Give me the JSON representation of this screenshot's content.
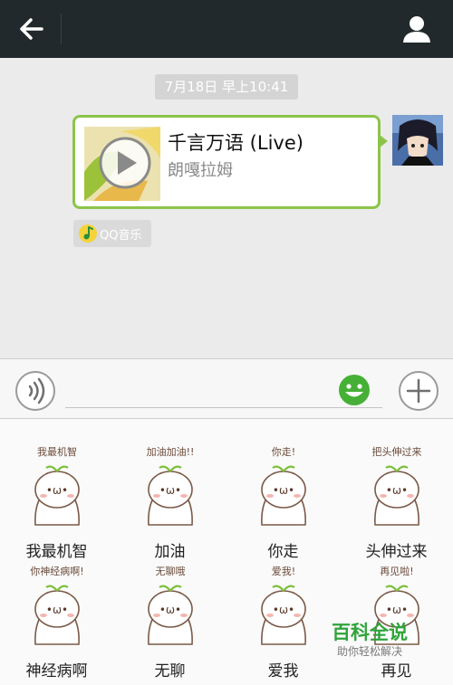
{
  "colors": {
    "topbar": "#22292c",
    "accent_green": "#8cc44b",
    "emoji_green": "#45b035",
    "watermark_green": "#2fa43b"
  },
  "header": {
    "back_icon": "arrow-left-icon",
    "profile_icon": "person-icon"
  },
  "chat": {
    "timestamp": "7月18日 早上10:41",
    "music_card": {
      "title": "千言万语 (Live)",
      "artist": "朗嘎拉姆",
      "icon": "play-icon"
    },
    "source": {
      "label": "QQ音乐",
      "icon": "qq-music-icon"
    }
  },
  "input_bar": {
    "voice_icon": "voice-icon",
    "text_value": "",
    "emoji_icon": "smiley-icon",
    "more_icon": "plus-icon"
  },
  "stickers": [
    {
      "label": "我最机智",
      "caption": "我最机智"
    },
    {
      "label": "加油",
      "caption": "加油加油!!"
    },
    {
      "label": "你走",
      "caption": "你走!"
    },
    {
      "label": "头伸过来",
      "caption": "把头伸过来"
    },
    {
      "label": "神经病啊",
      "caption": "你神经病啊!"
    },
    {
      "label": "无聊",
      "caption": "无聊哦"
    },
    {
      "label": "爱我",
      "caption": "爱我!"
    },
    {
      "label": "再见",
      "caption": "再见啦!"
    }
  ],
  "watermark": {
    "title": "百科全说",
    "subtitle": "助你轻松解决"
  }
}
